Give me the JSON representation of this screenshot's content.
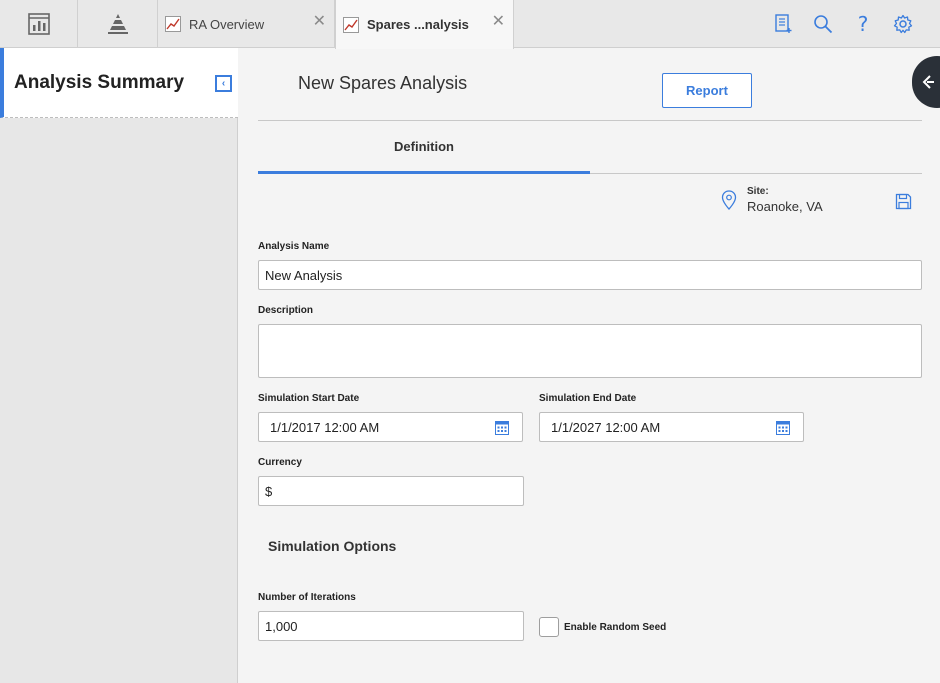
{
  "tabs": [
    {
      "label": "RA Overview",
      "active": false
    },
    {
      "label": "Spares ...nalysis",
      "active": true
    }
  ],
  "toolbar_icons": [
    "dashboard-icon",
    "pyramid-icon",
    "report-list-icon",
    "search-icon",
    "help-icon",
    "settings-icon"
  ],
  "left_panel": {
    "title": "Analysis Summary"
  },
  "main": {
    "title": "New Spares Analysis",
    "report_button": "Report",
    "tab_definition": "Definition",
    "site_label": "Site:",
    "site_value": "Roanoke, VA"
  },
  "form": {
    "analysis_name_label": "Analysis Name",
    "analysis_name_value": "New Analysis",
    "description_label": "Description",
    "description_value": "",
    "start_date_label": "Simulation Start Date",
    "start_date_value": "1/1/2017 12:00 AM",
    "end_date_label": "Simulation End Date",
    "end_date_value": "1/1/2027 12:00 AM",
    "currency_label": "Currency",
    "currency_value": "$",
    "simulation_options_title": "Simulation Options",
    "iterations_label": "Number of Iterations",
    "iterations_value": "1,000",
    "random_seed_label": "Enable Random Seed",
    "random_seed_checked": false
  },
  "colors": {
    "accent": "#3b7ddd",
    "chart_red": "#c0392b"
  }
}
